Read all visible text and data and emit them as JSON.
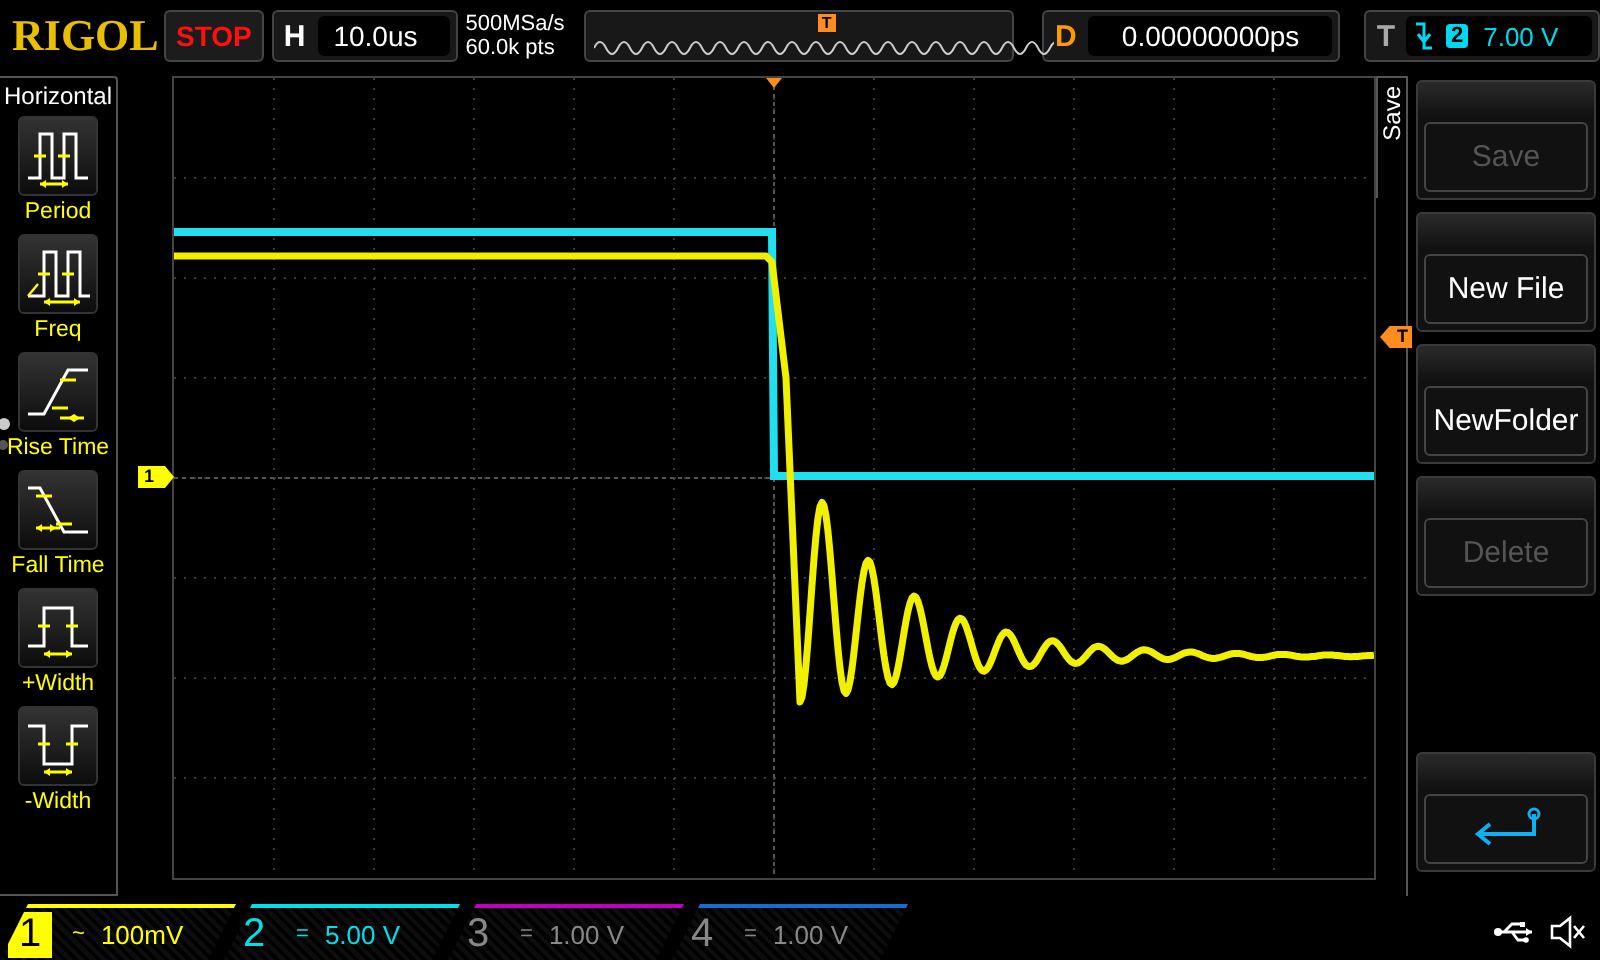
{
  "logo": "RIGOL",
  "run_status": "STOP",
  "timebase": {
    "label": "H",
    "value": "10.0us"
  },
  "acquisition": {
    "sample_rate": "500MSa/s",
    "memory_depth": "60.0k pts"
  },
  "trigger_position_marker": "T",
  "delay": {
    "label": "D",
    "value": "0.00000000ps"
  },
  "trigger": {
    "label": "T",
    "source": "2",
    "level": "7.00 V"
  },
  "measure_menu": {
    "title": "Horizontal",
    "pages": [
      {
        "selected": true
      },
      {
        "selected": false
      }
    ],
    "items": [
      {
        "kind": "period",
        "label": "Period"
      },
      {
        "kind": "freq",
        "label": "Freq"
      },
      {
        "kind": "rise",
        "label": "Rise Time"
      },
      {
        "kind": "fall",
        "label": "Fall Time"
      },
      {
        "kind": "pwidth",
        "label": "+Width"
      },
      {
        "kind": "nwidth",
        "label": "-Width"
      }
    ]
  },
  "markers": {
    "channel": "1",
    "trigger": "T"
  },
  "softkey_menu": {
    "title": "Save",
    "buttons": [
      {
        "kind": "text",
        "label": "Save",
        "disabled": true
      },
      {
        "kind": "text",
        "label": "New File",
        "disabled": false
      },
      {
        "kind": "text",
        "label": "NewFolder",
        "disabled": false
      },
      {
        "kind": "text",
        "label": "Delete",
        "disabled": true
      },
      {
        "kind": "gap"
      },
      {
        "kind": "back",
        "disabled": false
      }
    ]
  },
  "channels": [
    {
      "number": "1",
      "coupling": "~",
      "scale": "100mV",
      "color": "#ffff00",
      "on": true,
      "selected": true
    },
    {
      "number": "2",
      "coupling": "=",
      "scale": "5.00 V",
      "color": "#00e0e8",
      "on": true,
      "selected": false
    },
    {
      "number": "3",
      "coupling": "=",
      "scale": "1.00 V",
      "color": "#c000c0",
      "on": false,
      "selected": false
    },
    {
      "number": "4",
      "coupling": "=",
      "scale": "1.00 V",
      "color": "#1070d0",
      "on": false,
      "selected": false
    }
  ]
}
